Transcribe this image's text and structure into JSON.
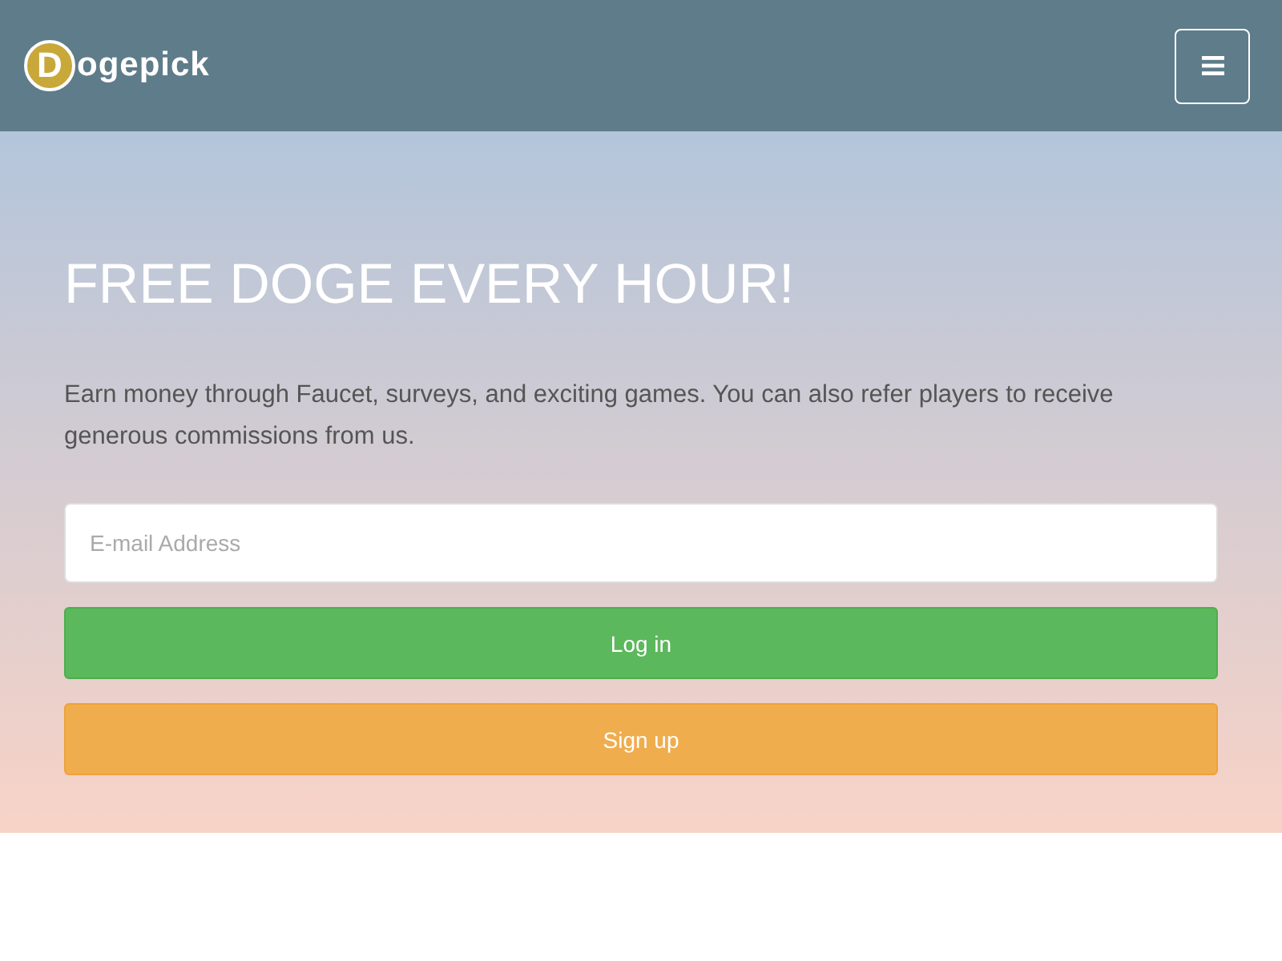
{
  "header": {
    "logo": {
      "initial": "D",
      "rest": "ogepick"
    }
  },
  "hero": {
    "title": "FREE DOGE EVERY HOUR!",
    "text": "Earn money through Faucet, surveys, and exciting games. You can also refer players to receive generous commissions from us.",
    "email": {
      "placeholder": "E-mail Address"
    },
    "buttons": [
      {
        "label": "Log in",
        "kind": "login"
      },
      {
        "label": "Sign up",
        "kind": "signup"
      }
    ]
  }
}
